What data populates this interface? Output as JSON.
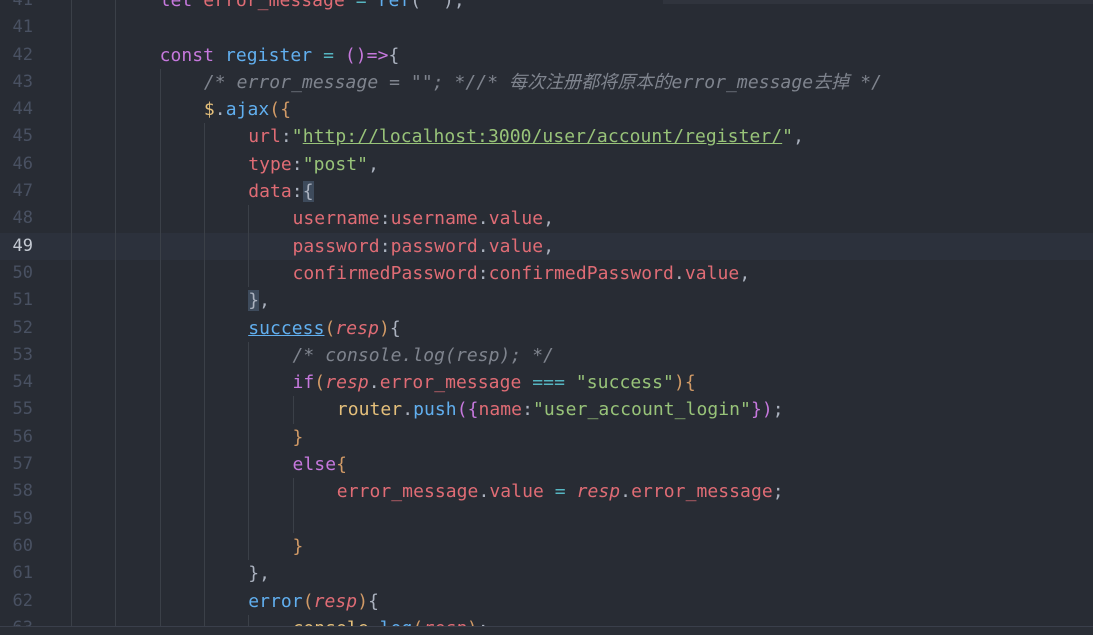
{
  "editor": {
    "active_line": 49,
    "lines": [
      {
        "n": "41",
        "indent": 2,
        "tokens": [
          {
            "c": "t-kw",
            "t": "let "
          },
          {
            "c": "t-prop",
            "t": "error_message"
          },
          {
            "c": "t-op",
            "t": " = "
          },
          {
            "c": "t-fn",
            "t": "ref"
          },
          {
            "c": "t-punct",
            "t": "("
          },
          {
            "c": "t-str",
            "t": "\"\""
          },
          {
            "c": "t-punct",
            "t": ");"
          }
        ]
      },
      {
        "n": "41",
        "indent": 0,
        "tokens": []
      },
      {
        "n": "42",
        "indent": 2,
        "tokens": [
          {
            "c": "t-kw",
            "t": "const "
          },
          {
            "c": "t-var",
            "t": "register"
          },
          {
            "c": "t-op",
            "t": " = "
          },
          {
            "c": "t-kw",
            "t": "()=>"
          },
          {
            "c": "t-punct",
            "t": "{"
          }
        ]
      },
      {
        "n": "43",
        "indent": 3,
        "tokens": [
          {
            "c": "t-comment",
            "t": "/* error_message = \"\"; *//* 每次注册都将原本的error_message去掉 */"
          }
        ]
      },
      {
        "n": "44",
        "indent": 3,
        "tokens": [
          {
            "c": "t-yellow",
            "t": "$"
          },
          {
            "c": "t-punct",
            "t": "."
          },
          {
            "c": "t-fn",
            "t": "ajax"
          },
          {
            "c": "t-brace",
            "t": "({"
          }
        ]
      },
      {
        "n": "45",
        "indent": 4,
        "tokens": [
          {
            "c": "t-prop",
            "t": "url"
          },
          {
            "c": "t-punct",
            "t": ":"
          },
          {
            "c": "t-str",
            "t": "\""
          },
          {
            "c": "t-url",
            "t": "http://localhost:3000/user/account/register/"
          },
          {
            "c": "t-str",
            "t": "\""
          },
          {
            "c": "t-punct",
            "t": ","
          }
        ]
      },
      {
        "n": "46",
        "indent": 4,
        "tokens": [
          {
            "c": "t-prop",
            "t": "type"
          },
          {
            "c": "t-punct",
            "t": ":"
          },
          {
            "c": "t-str",
            "t": "\"post\""
          },
          {
            "c": "t-punct",
            "t": ","
          }
        ]
      },
      {
        "n": "47",
        "indent": 4,
        "tokens": [
          {
            "c": "t-prop",
            "t": "data"
          },
          {
            "c": "t-punct",
            "t": ":"
          },
          {
            "c": "t-punct t-hl",
            "t": "{"
          }
        ]
      },
      {
        "n": "48",
        "indent": 5,
        "tokens": [
          {
            "c": "t-prop",
            "t": "username"
          },
          {
            "c": "t-punct",
            "t": ":"
          },
          {
            "c": "t-prop",
            "t": "username"
          },
          {
            "c": "t-punct",
            "t": "."
          },
          {
            "c": "t-prop",
            "t": "value"
          },
          {
            "c": "t-punct",
            "t": ","
          }
        ]
      },
      {
        "n": "49",
        "indent": 5,
        "tokens": [
          {
            "c": "t-prop",
            "t": "password"
          },
          {
            "c": "t-punct",
            "t": ":"
          },
          {
            "c": "t-prop",
            "t": "password"
          },
          {
            "c": "t-punct",
            "t": "."
          },
          {
            "c": "t-prop",
            "t": "value"
          },
          {
            "c": "t-punct",
            "t": ","
          }
        ]
      },
      {
        "n": "50",
        "indent": 5,
        "tokens": [
          {
            "c": "t-prop",
            "t": "confirmedPassword"
          },
          {
            "c": "t-punct",
            "t": ":"
          },
          {
            "c": "t-prop",
            "t": "confirmedPassword"
          },
          {
            "c": "t-punct",
            "t": "."
          },
          {
            "c": "t-prop",
            "t": "value"
          },
          {
            "c": "t-punct",
            "t": ","
          }
        ]
      },
      {
        "n": "51",
        "indent": 4,
        "tokens": [
          {
            "c": "t-punct t-hl",
            "t": "}"
          },
          {
            "c": "t-punct",
            "t": ","
          }
        ]
      },
      {
        "n": "52",
        "indent": 4,
        "tokens": [
          {
            "c": "t-fn t-uline",
            "t": "success"
          },
          {
            "c": "t-brace",
            "t": "("
          },
          {
            "c": "t-param",
            "t": "resp"
          },
          {
            "c": "t-brace",
            "t": ")"
          },
          {
            "c": "t-punct",
            "t": "{"
          }
        ]
      },
      {
        "n": "53",
        "indent": 5,
        "tokens": [
          {
            "c": "t-comment",
            "t": "/* console.log(resp); */"
          }
        ]
      },
      {
        "n": "54",
        "indent": 5,
        "tokens": [
          {
            "c": "t-kw",
            "t": "if"
          },
          {
            "c": "t-brace",
            "t": "("
          },
          {
            "c": "t-param",
            "t": "resp"
          },
          {
            "c": "t-punct",
            "t": "."
          },
          {
            "c": "t-prop",
            "t": "error_message"
          },
          {
            "c": "t-op",
            "t": " === "
          },
          {
            "c": "t-str",
            "t": "\"success\""
          },
          {
            "c": "t-brace",
            "t": ")"
          },
          {
            "c": "t-brace",
            "t": "{"
          }
        ]
      },
      {
        "n": "55",
        "indent": 6,
        "tokens": [
          {
            "c": "t-yellow",
            "t": "router"
          },
          {
            "c": "t-punct",
            "t": "."
          },
          {
            "c": "t-fn",
            "t": "push"
          },
          {
            "c": "t-kw",
            "t": "({"
          },
          {
            "c": "t-prop",
            "t": "name"
          },
          {
            "c": "t-punct",
            "t": ":"
          },
          {
            "c": "t-str",
            "t": "\"user_account_login\""
          },
          {
            "c": "t-kw",
            "t": "})"
          },
          {
            "c": "t-punct",
            "t": ";"
          }
        ]
      },
      {
        "n": "56",
        "indent": 5,
        "tokens": [
          {
            "c": "t-brace",
            "t": "}"
          }
        ]
      },
      {
        "n": "57",
        "indent": 5,
        "tokens": [
          {
            "c": "t-kw",
            "t": "else"
          },
          {
            "c": "t-brace",
            "t": "{"
          }
        ]
      },
      {
        "n": "58",
        "indent": 6,
        "tokens": [
          {
            "c": "t-prop",
            "t": "error_message"
          },
          {
            "c": "t-punct",
            "t": "."
          },
          {
            "c": "t-prop",
            "t": "value"
          },
          {
            "c": "t-op",
            "t": " = "
          },
          {
            "c": "t-param",
            "t": "resp"
          },
          {
            "c": "t-punct",
            "t": "."
          },
          {
            "c": "t-prop",
            "t": "error_message"
          },
          {
            "c": "t-punct",
            "t": ";"
          }
        ]
      },
      {
        "n": "59",
        "indent": 0,
        "tokens": []
      },
      {
        "n": "60",
        "indent": 5,
        "tokens": [
          {
            "c": "t-brace",
            "t": "}"
          }
        ]
      },
      {
        "n": "61",
        "indent": 4,
        "tokens": [
          {
            "c": "t-punct",
            "t": "},"
          }
        ]
      },
      {
        "n": "62",
        "indent": 4,
        "tokens": [
          {
            "c": "t-fn",
            "t": "error"
          },
          {
            "c": "t-brace",
            "t": "("
          },
          {
            "c": "t-param",
            "t": "resp"
          },
          {
            "c": "t-brace",
            "t": ")"
          },
          {
            "c": "t-punct",
            "t": "{"
          }
        ]
      },
      {
        "n": "63",
        "indent": 5,
        "tokens": [
          {
            "c": "t-yellow",
            "t": "console"
          },
          {
            "c": "t-punct",
            "t": "."
          },
          {
            "c": "t-fn",
            "t": "log"
          },
          {
            "c": "t-brace",
            "t": "("
          },
          {
            "c": "t-param",
            "t": "resp"
          },
          {
            "c": "t-brace",
            "t": ")"
          },
          {
            "c": "t-punct",
            "t": ";"
          }
        ]
      }
    ]
  }
}
